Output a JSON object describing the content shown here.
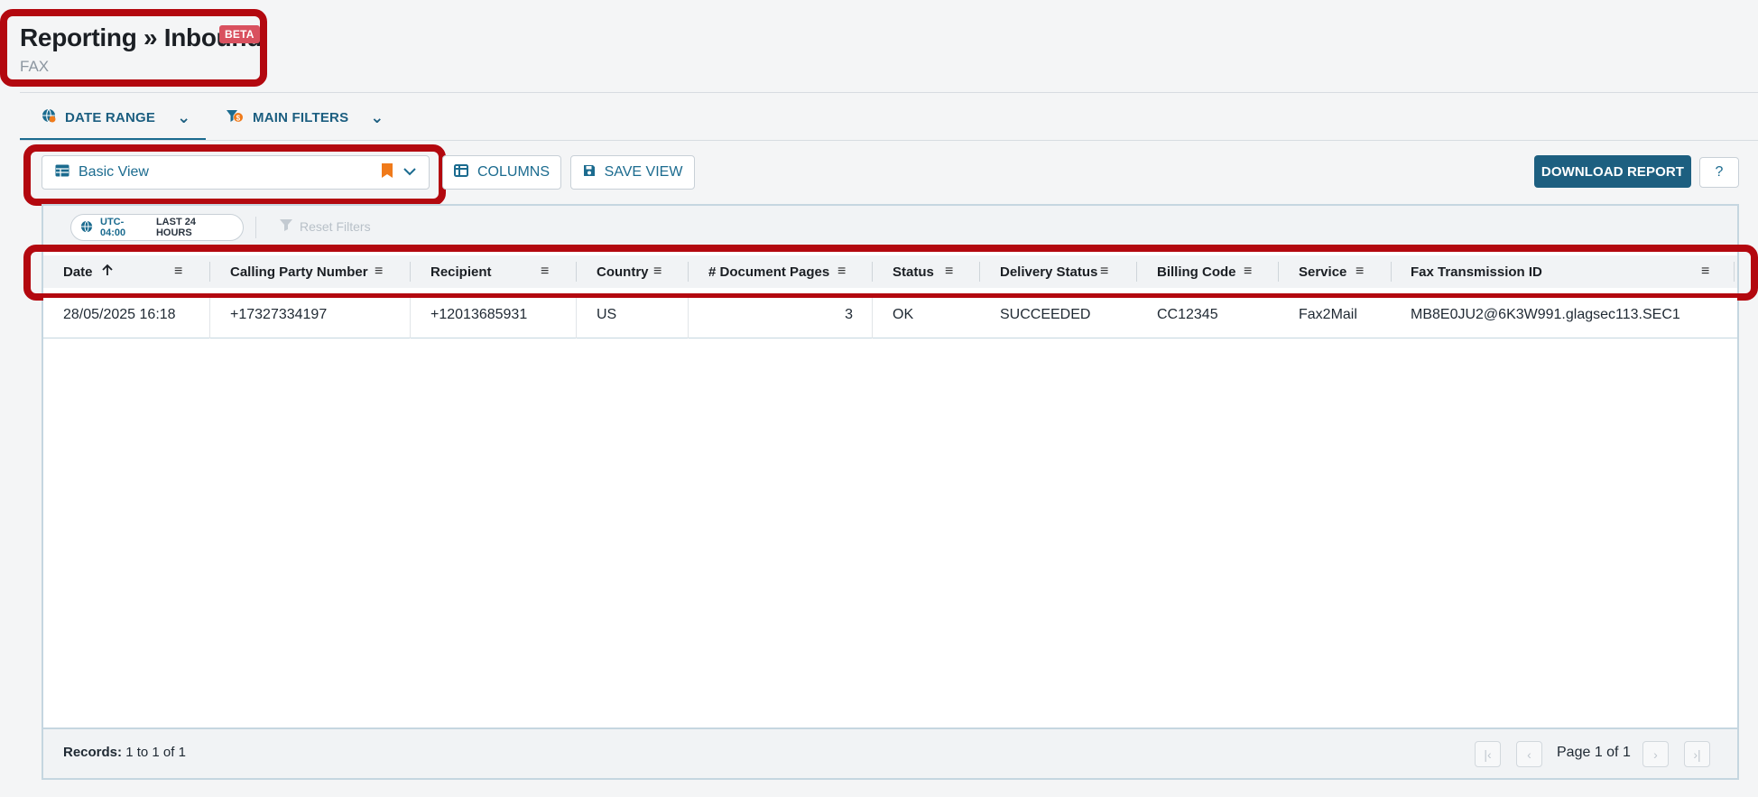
{
  "header": {
    "title": "Reporting » Inbound",
    "badge": "BETA",
    "subtitle": "FAX"
  },
  "tabs": [
    {
      "label": "DATE RANGE",
      "active": true
    },
    {
      "label": "MAIN FILTERS",
      "active": false
    }
  ],
  "toolbar": {
    "view_label": "Basic View",
    "columns_label": "COLUMNS",
    "save_view_label": "SAVE VIEW",
    "download_label": "DOWNLOAD REPORT",
    "help_label": "?"
  },
  "filters": {
    "timezone": "UTC-04:00",
    "range": "LAST 24 HOURS",
    "reset_label": "Reset Filters"
  },
  "table": {
    "columns": [
      "Date",
      "Calling Party Number",
      "Recipient",
      "Country",
      "# Document Pages",
      "Status",
      "Delivery Status",
      "Billing Code",
      "Service",
      "Fax Transmission ID"
    ],
    "sort": {
      "column": "Date",
      "direction": "ascending"
    },
    "rows": [
      [
        "28/05/2025 16:18",
        "+17327334197",
        "+12013685931",
        "US",
        "3",
        "OK",
        "SUCCEEDED",
        "CC12345",
        "Fax2Mail",
        "MB8E0JU2@6K3W991.glagsec113.SEC1"
      ]
    ]
  },
  "footer": {
    "records_label": "Records:",
    "records_value": "1 to 1 of 1",
    "page_text": "Page 1 of 1"
  },
  "colors": {
    "accent": "#1b6b8f",
    "primary_button": "#1d5f80",
    "beta_badge": "#d9515f",
    "annotation": "#b3080f",
    "bookmark": "#f07a1a"
  }
}
